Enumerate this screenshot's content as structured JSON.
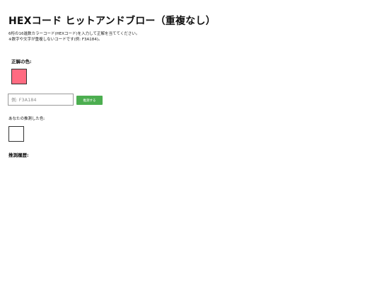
{
  "header": {
    "title": "HEXコード ヒットアンドブロー（重複なし）"
  },
  "description": {
    "line1": "6桁の16進数カラーコード(HEXコード)を入力して正解を当ててください。",
    "line2": "※数字や文字が重複しないコードです(例: F3A184)。"
  },
  "answer": {
    "label": "正解の色:",
    "color": "#ff6b81"
  },
  "guess": {
    "input_value": "",
    "placeholder": "例: F3A184",
    "button_label": "推測する",
    "button_color": "#4cae50"
  },
  "your_color": {
    "label": "あなたの推測した色:",
    "color": "#ffffff"
  },
  "history": {
    "label": "推測履歴:",
    "items": []
  }
}
